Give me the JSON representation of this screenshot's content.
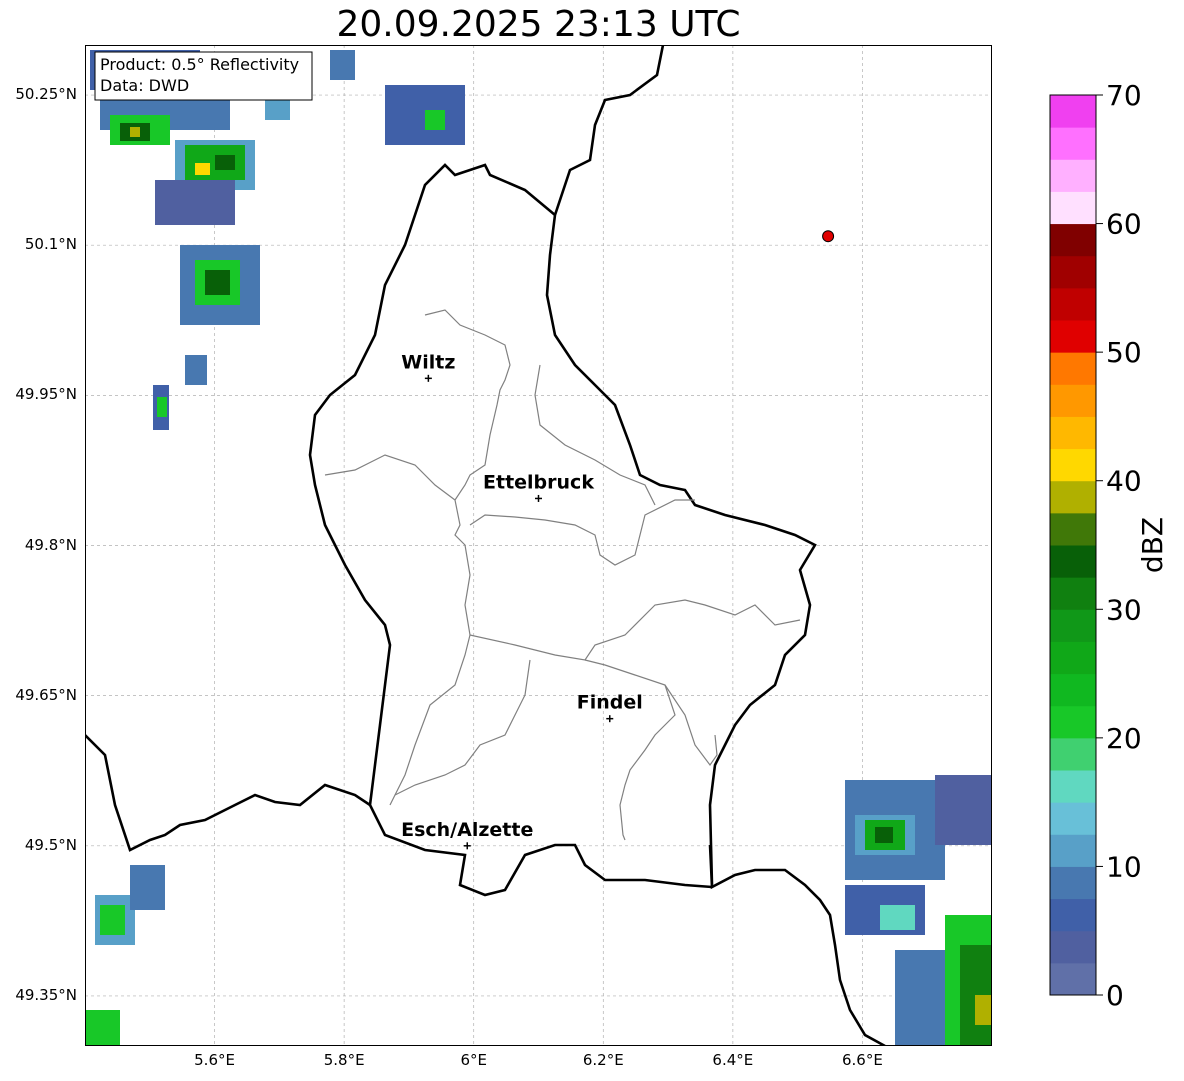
{
  "title": "20.09.2025 23:13 UTC",
  "info_box": {
    "line1": "Product: 0.5° Reflectivity",
    "line2": "Data: DWD"
  },
  "map": {
    "lon_range": [
      5.4,
      6.8
    ],
    "lat_range": [
      49.3,
      50.3
    ],
    "lon_ticks": [
      {
        "value": 5.6,
        "label": "5.6°E"
      },
      {
        "value": 5.8,
        "label": "5.8°E"
      },
      {
        "value": 6.0,
        "label": "6°E"
      },
      {
        "value": 6.2,
        "label": "6.2°E"
      },
      {
        "value": 6.4,
        "label": "6.4°E"
      },
      {
        "value": 6.6,
        "label": "6.6°E"
      }
    ],
    "lat_ticks": [
      {
        "value": 50.25,
        "label": "50.25°N"
      },
      {
        "value": 50.1,
        "label": "50.1°N"
      },
      {
        "value": 49.95,
        "label": "49.95°N"
      },
      {
        "value": 49.8,
        "label": "49.8°N"
      },
      {
        "value": 49.65,
        "label": "49.65°N"
      },
      {
        "value": 49.5,
        "label": "49.5°N"
      },
      {
        "value": 49.35,
        "label": "49.35°N"
      }
    ],
    "cities": [
      {
        "name": "Wiltz",
        "lon": 5.93,
        "lat": 49.967
      },
      {
        "name": "Ettelbruck",
        "lon": 6.1,
        "lat": 49.847
      },
      {
        "name": "Findel",
        "lon": 6.21,
        "lat": 49.627
      },
      {
        "name": "Esch/Alzette",
        "lon": 5.99,
        "lat": 49.5
      }
    ],
    "radar_site": {
      "lon": 6.547,
      "lat": 50.109,
      "color": "#e00000"
    }
  },
  "colorbar": {
    "label": "dBZ",
    "min": 0,
    "max": 70,
    "ticks": [
      {
        "value": 0,
        "label": "0"
      },
      {
        "value": 10,
        "label": "10"
      },
      {
        "value": 20,
        "label": "20"
      },
      {
        "value": 30,
        "label": "30"
      },
      {
        "value": 40,
        "label": "40"
      },
      {
        "value": 50,
        "label": "50"
      },
      {
        "value": 60,
        "label": "60"
      },
      {
        "value": 70,
        "label": "70"
      }
    ],
    "colors": [
      "#6070a8",
      "#5060a0",
      "#4060a8",
      "#4878b0",
      "#58a0c8",
      "#68c0d8",
      "#60d8c0",
      "#40d070",
      "#18c828",
      "#10b820",
      "#10a818",
      "#109818",
      "#108010",
      "#086008",
      "#407808",
      "#b0b000",
      "#ffd800",
      "#ffb800",
      "#ff9800",
      "#ff7800",
      "#e00000",
      "#c00000",
      "#a00000",
      "#800000",
      "#ffe0ff",
      "#ffb0ff",
      "#ff70ff",
      "#f040f0"
    ]
  }
}
